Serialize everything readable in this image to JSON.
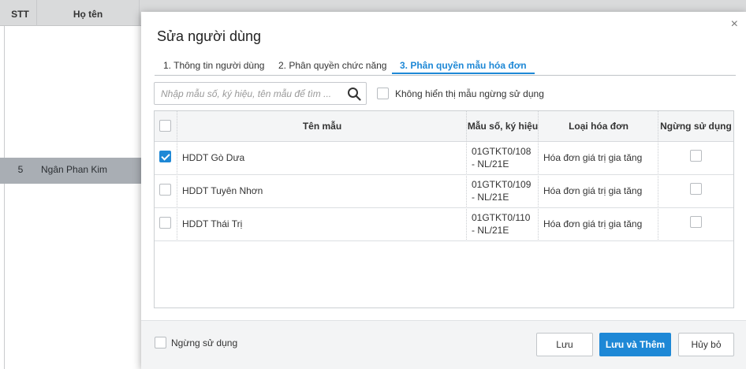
{
  "background_table": {
    "columns": [
      "STT",
      "Họ tên"
    ],
    "selected_row": {
      "stt": "5",
      "name": "Ngân Phan Kim"
    }
  },
  "dialog": {
    "title": "Sửa người dùng",
    "close_icon": "×",
    "tabs": [
      {
        "label": "1. Thông tin người dùng",
        "active": false
      },
      {
        "label": "2. Phân quyền chức năng",
        "active": false
      },
      {
        "label": "3. Phân quyền mẫu hóa đơn",
        "active": true
      }
    ],
    "search": {
      "placeholder": "Nhập mẫu số, ký hiệu, tên mẫu để tìm ...",
      "value": "",
      "icon": "search-icon"
    },
    "hide_inactive_label": "Không hiển thị mẫu ngừng sử dụng",
    "grid": {
      "headers": [
        "Tên mẫu",
        "Mẫu số, ký hiệu",
        "Loại hóa đơn",
        "Ngừng sử dụng"
      ],
      "rows": [
        {
          "checked": true,
          "name": "HDDT Gò Dưa",
          "code_line1": "01GTKT0/108",
          "code_line2": "- NL/21E",
          "type": "Hóa đơn giá trị gia tăng",
          "inactive": false
        },
        {
          "checked": false,
          "name": "HDDT Tuyên Nhơn",
          "code_line1": "01GTKT0/109",
          "code_line2": "- NL/21E",
          "type": "Hóa đơn giá trị gia tăng",
          "inactive": false
        },
        {
          "checked": false,
          "name": "HDDT Thái Trị",
          "code_line1": "01GTKT0/110",
          "code_line2": "- NL/21E",
          "type": "Hóa đơn giá trị gia tăng",
          "inactive": false
        }
      ]
    },
    "footer": {
      "inactive_label": "Ngừng sử dụng",
      "save_label": "Lưu",
      "save_add_label": "Lưu và Thêm",
      "cancel_label": "Hủy bỏ"
    },
    "colors": {
      "accent": "#1e88d6",
      "overlay_row": "#a9aeb4"
    }
  }
}
